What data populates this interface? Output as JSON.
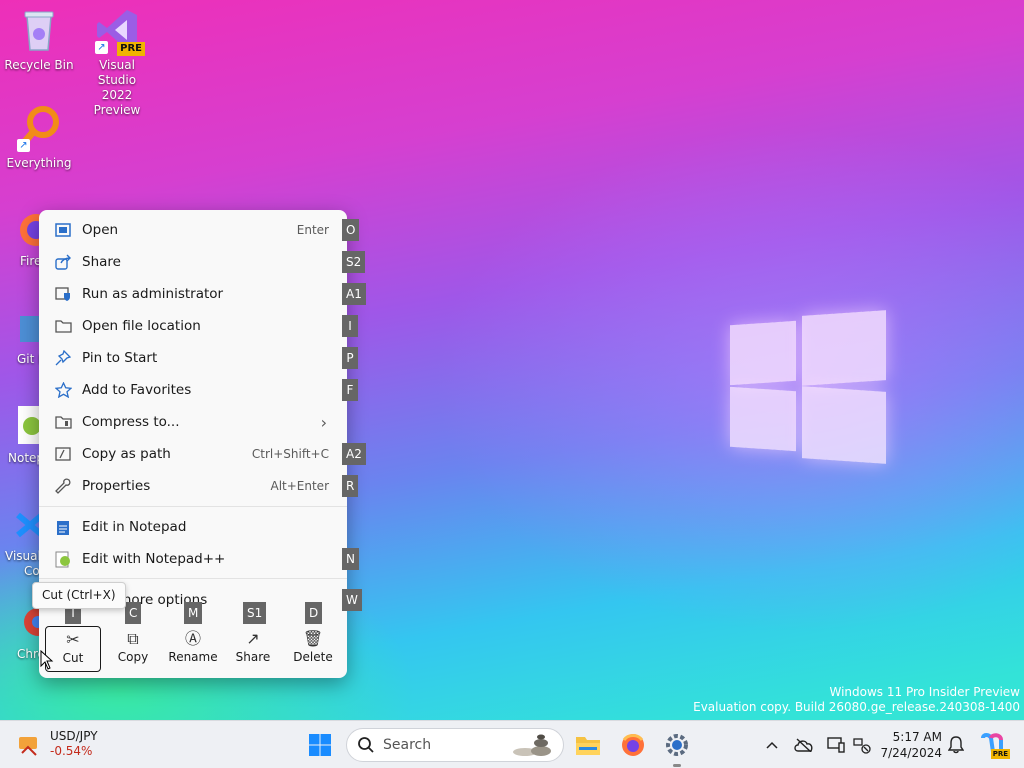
{
  "desktop": {
    "icons": [
      {
        "label": "Recycle Bin"
      },
      {
        "label": "Visual Studio 2022 Preview",
        "line1": "Visual Studio",
        "line2": "2022 Preview",
        "badge": "PRE"
      },
      {
        "label": "Everything"
      }
    ],
    "partial_labels": [
      "Fire",
      "Git B",
      "Notep",
      "Visual",
      "Co",
      "Chro"
    ]
  },
  "watermark": {
    "line1": "Windows 11 Pro Insider Preview",
    "line2": "Evaluation copy. Build 26080.ge_release.240308-1400"
  },
  "context_menu": {
    "items": [
      {
        "label": "Open",
        "shortcut": "Enter",
        "key": "O",
        "icon": "open-icon"
      },
      {
        "label": "Share",
        "shortcut": "",
        "key": "S2",
        "icon": "share-icon"
      },
      {
        "label": "Run as administrator",
        "shortcut": "",
        "key": "A1",
        "icon": "shield-icon"
      },
      {
        "label": "Open file location",
        "shortcut": "",
        "key": "I",
        "icon": "folder-icon"
      },
      {
        "label": "Pin to Start",
        "shortcut": "",
        "key": "P",
        "icon": "pin-icon"
      },
      {
        "label": "Add to Favorites",
        "shortcut": "",
        "key": "F",
        "icon": "star-icon"
      },
      {
        "label": "Compress to...",
        "shortcut": "",
        "key": "",
        "icon": "zip-icon",
        "submenu": "›"
      },
      {
        "label": "Copy as path",
        "shortcut": "Ctrl+Shift+C",
        "key": "A2",
        "icon": "path-icon"
      },
      {
        "label": "Properties",
        "shortcut": "Alt+Enter",
        "key": "R",
        "icon": "wrench-icon"
      },
      {
        "label": "Edit in Notepad",
        "shortcut": "",
        "key": "",
        "icon": "notepad-icon"
      },
      {
        "label": "Edit with Notepad++",
        "shortcut": "",
        "key": "N",
        "icon": "notepadpp-icon"
      },
      {
        "label": "Show more options",
        "visible_text": "v more options",
        "shortcut": "",
        "key": "W",
        "icon": "more-icon"
      }
    ],
    "quick_actions": [
      {
        "label": "Cut",
        "key": "T",
        "glyph": "✂"
      },
      {
        "label": "Copy",
        "key": "C",
        "glyph": "⧉"
      },
      {
        "label": "Rename",
        "key": "M",
        "glyph": "Ⓐ"
      },
      {
        "label": "Share",
        "key": "S1",
        "glyph": "↗"
      },
      {
        "label": "Delete",
        "key": "D",
        "glyph": "🗑"
      }
    ],
    "tooltip": "Cut (Ctrl+X)"
  },
  "taskbar": {
    "ticker_symbol": "USD/JPY",
    "ticker_change": "-0.54%",
    "search_placeholder": "Search",
    "time": "5:17 AM",
    "date": "7/24/2024",
    "copilot_badge": "PRE"
  },
  "colors": {
    "accent": "#2b6fc9",
    "negative": "#c42b1c",
    "key_hint_bg": "#666666"
  }
}
